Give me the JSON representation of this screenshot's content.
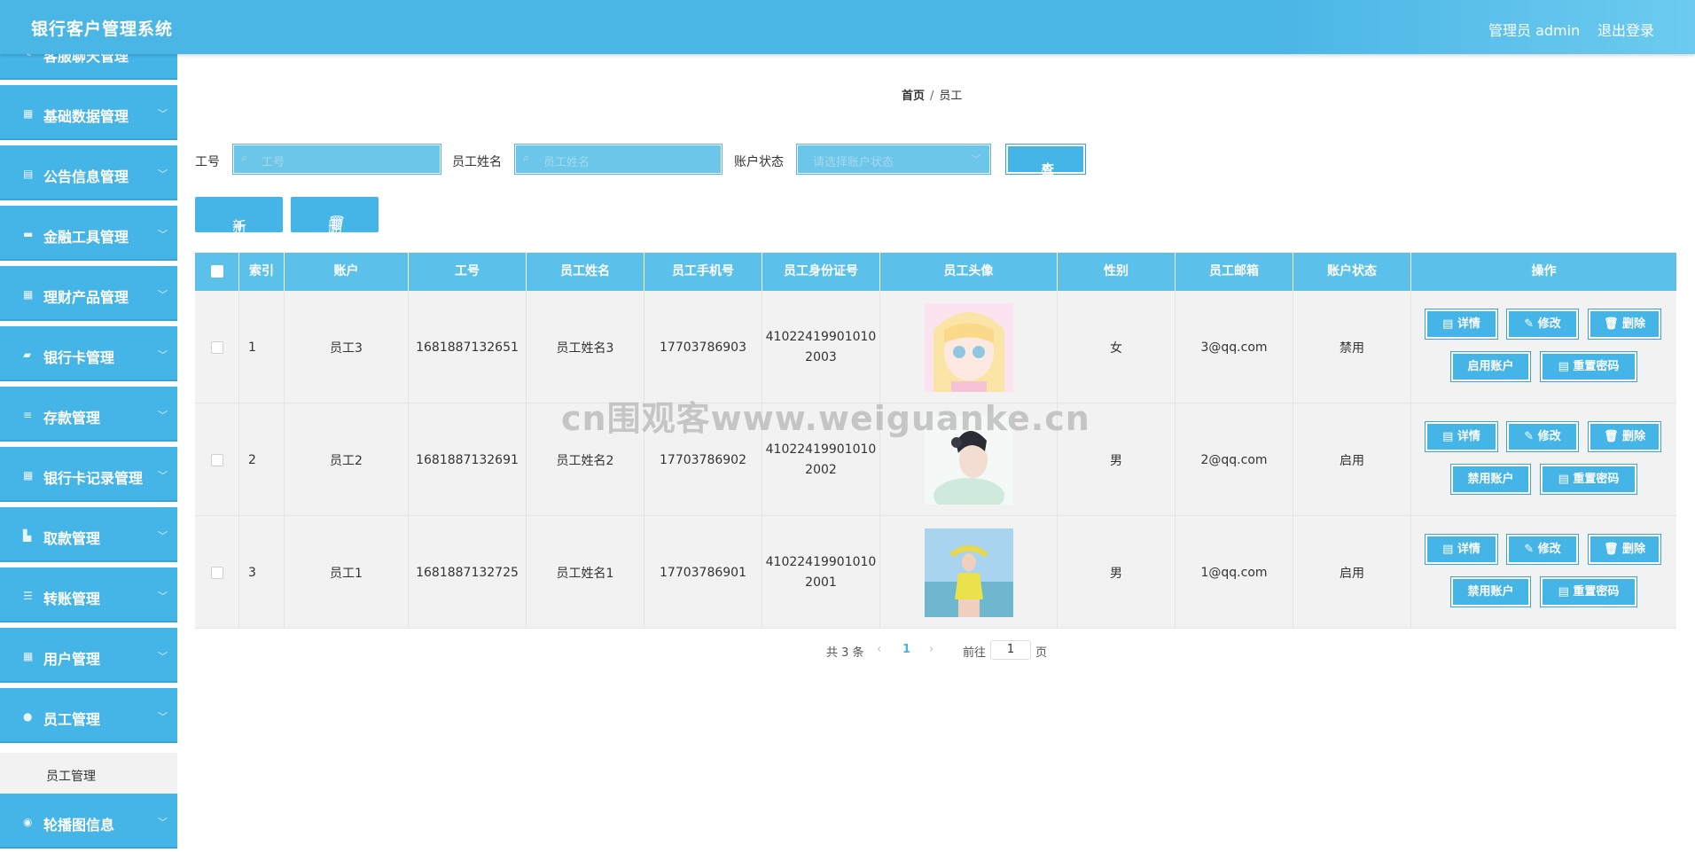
{
  "header": {
    "title": "银行客户管理系统",
    "admin": "管理员 admin",
    "logout": "退出登录"
  },
  "sidebar": {
    "items": [
      {
        "label": "客服聊天管理",
        "icon": "chat-icon"
      },
      {
        "label": "基础数据管理",
        "icon": "grid-icon"
      },
      {
        "label": "公告信息管理",
        "icon": "clipboard-icon"
      },
      {
        "label": "金融工具管理",
        "icon": "stamp-icon"
      },
      {
        "label": "理财产品管理",
        "icon": "grid-icon"
      },
      {
        "label": "银行卡管理",
        "icon": "ticket-icon"
      },
      {
        "label": "存款管理",
        "icon": "list-icon"
      },
      {
        "label": "银行卡记录管理",
        "icon": "grid-icon"
      },
      {
        "label": "取款管理",
        "icon": "thumb-icon"
      },
      {
        "label": "转账管理",
        "icon": "sliders-icon"
      },
      {
        "label": "用户管理",
        "icon": "grid-icon"
      },
      {
        "label": "员工管理",
        "icon": "user-icon"
      },
      {
        "label": "轮播图信息",
        "icon": "pin-icon"
      }
    ],
    "submenu": "员工管理"
  },
  "breadcrumb": {
    "home": "首页",
    "sep": "/",
    "current": "员工"
  },
  "filters": {
    "job_no_label": "工号",
    "job_no_placeholder": "工号",
    "name_label": "员工姓名",
    "name_placeholder": "员工姓名",
    "status_label": "账户状态",
    "status_placeholder": "请选择账户状态",
    "query": "查询"
  },
  "actions": {
    "add": "新增",
    "delete": "删除"
  },
  "table": {
    "headers": [
      "索引",
      "账户",
      "工号",
      "员工姓名",
      "员工手机号",
      "员工身份证号",
      "员工头像",
      "性别",
      "员工邮箱",
      "账户状态",
      "操作"
    ],
    "rows": [
      {
        "index": "1",
        "account": "员工3",
        "job_no": "1681887132651",
        "name": "员工姓名3",
        "phone": "17703786903",
        "id1": "41022419901010",
        "id2": "2003",
        "gender": "女",
        "email": "3@qq.com",
        "status": "禁用",
        "toggle": "启用账户"
      },
      {
        "index": "2",
        "account": "员工2",
        "job_no": "1681887132691",
        "name": "员工姓名2",
        "phone": "17703786902",
        "id1": "41022419901010",
        "id2": "2002",
        "gender": "男",
        "email": "2@qq.com",
        "status": "启用",
        "toggle": "禁用账户"
      },
      {
        "index": "3",
        "account": "员工1",
        "job_no": "1681887132725",
        "name": "员工姓名1",
        "phone": "17703786901",
        "id1": "41022419901010",
        "id2": "2001",
        "gender": "男",
        "email": "1@qq.com",
        "status": "启用",
        "toggle": "禁用账户"
      }
    ],
    "ops": {
      "detail": "详情",
      "edit": "修改",
      "delete": "删除",
      "reset": "重置密码"
    }
  },
  "pagination": {
    "total": "共 3 条",
    "page": "1",
    "goto": "前往",
    "goto_value": "1",
    "unit": "页"
  },
  "watermark": "cn围观客www.weiguanke.cn",
  "colors": {
    "primary": "#45b4e6",
    "header": "#4ab6e6",
    "table_head": "#5bc0ea"
  }
}
